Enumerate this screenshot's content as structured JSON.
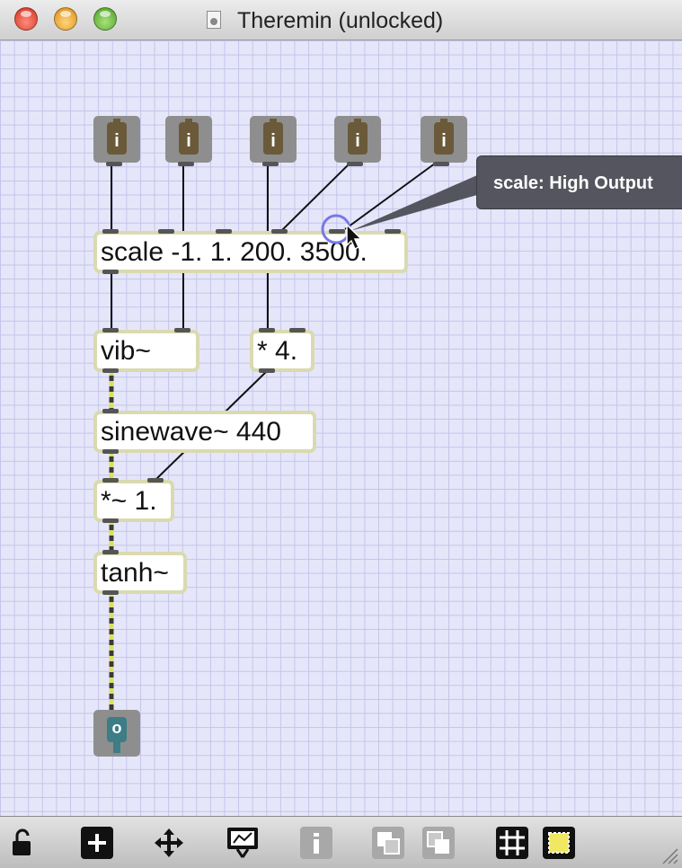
{
  "window": {
    "title": "Theremin (unlocked)"
  },
  "patcher": {
    "inlet_glyph": "i",
    "outlet_glyph": "o",
    "objects": {
      "scale": "scale -1. 1. 200. 3500.",
      "vib": "vib~",
      "mult": "* 4.",
      "sinewave": "sinewave~ 440",
      "sigmult": "*~ 1.",
      "tanh": "tanh~"
    },
    "tooltip": "scale: High Output"
  },
  "toolbar": {
    "items": [
      "lock-icon",
      "new-object-icon",
      "move-icon",
      "presentation-icon",
      "inspector-icon",
      "bring-front-icon",
      "send-back-icon",
      "grid-icon",
      "snap-to-grid-icon"
    ]
  },
  "colors": {
    "canvas": "#e6e6fa",
    "grid": "#c4c4ea",
    "signal_cable_yellow": "#d8e060",
    "object_border": "#dadab0",
    "inlet": "#6a5a3a",
    "outlet": "#3c7d86",
    "tooltip": "#55555f"
  }
}
